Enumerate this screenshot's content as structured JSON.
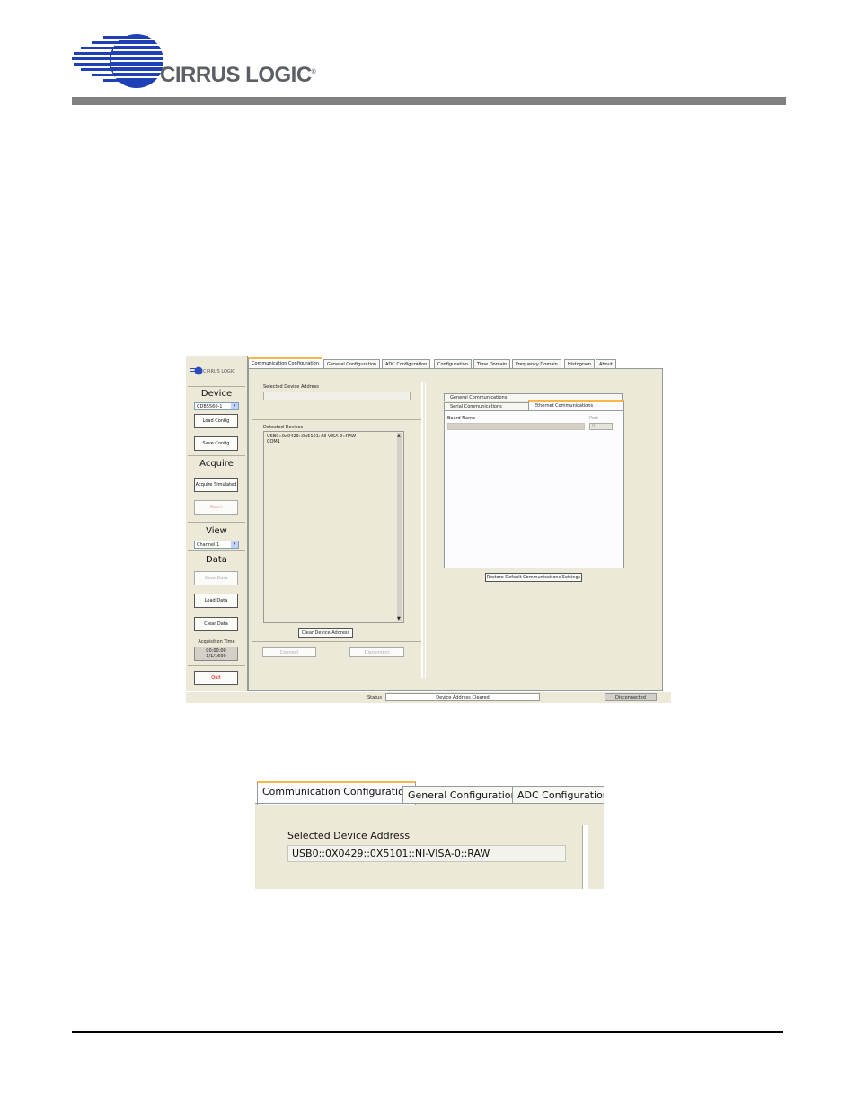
{
  "header": {
    "logo_text": "CIRRUS LOGIC",
    "registered": "®"
  },
  "app": {
    "sidebar": {
      "logo_text": "CIRRUS LOGIC",
      "device_title": "Device",
      "device_select": "CDB5560-1",
      "load_config": "Load Config",
      "save_config": "Save Config",
      "acquire_title": "Acquire",
      "acquire_simulated": "Acquire Simulated",
      "abort": "Abort",
      "view_title": "View",
      "channel_select": "Channel 1",
      "data_title": "Data",
      "save_data": "Save Data",
      "load_data": "Load Data",
      "clear_data": "Clear Data",
      "acq_time_label": "Acquisition Time",
      "acq_time_value": "00:00:00",
      "acq_date_value": "1/1/1600",
      "quit": "Quit"
    },
    "tabs": [
      "Communication Configuration",
      "General Configuration",
      "ADC Configuration",
      "Configuration",
      "Time Domain",
      "Frequency Domain",
      "Histogram",
      "About"
    ],
    "comm": {
      "selected_address_label": "Selected Device Address",
      "selected_address_value": "",
      "detected_label": "Detected Devices",
      "detected_items": [
        "USB0::0x0429::0x5101::NI-VISA-0::RAW",
        "COM1"
      ],
      "clear_address_button": "Clear Device Address",
      "connect_button": "Connect",
      "disconnect_button": "Disconnect",
      "subtabs": [
        "General Communications",
        "Serial Communications",
        "Ethernet Communications"
      ],
      "board_name_label": "Board Name",
      "port_label": "Port",
      "port_value": "0",
      "restore_button": "Restore Default Communications Settings"
    },
    "status": {
      "label": "Status",
      "message": "Device Address Cleared",
      "connection": "Disconnected"
    }
  },
  "zoom": {
    "tabs": [
      "Communication Configuration",
      "General Configuration",
      "ADC Configuration"
    ],
    "selected_address_label": "Selected Device Address",
    "selected_address_value": "USB0::0X0429::0X5101::NI-VISA-0::RAW"
  }
}
